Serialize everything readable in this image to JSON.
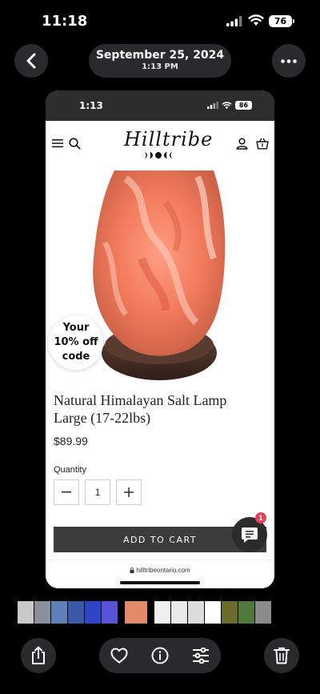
{
  "os_status": {
    "time": "11:18",
    "battery": "76"
  },
  "header": {
    "date": "September 25, 2024",
    "time": "1:13 PM"
  },
  "screenshot": {
    "status": {
      "time": "1:13",
      "battery": "86"
    },
    "site": {
      "logo_text": "Hilltribe"
    },
    "offer_bubble": {
      "line1": "Your",
      "line2": "10% off",
      "line3": "code"
    },
    "product": {
      "title": "Natural Himalayan Salt Lamp Large (17-22lbs)",
      "price": "$89.99",
      "quantity_label": "Quantity",
      "quantity_value": "1",
      "add_to_cart": "ADD TO CART"
    },
    "chat_badge": "1",
    "url": "hilltribeontario.com"
  },
  "thumbnails": [
    {
      "color": "#c9c9c9"
    },
    {
      "color": "#8a8f9c"
    },
    {
      "color": "#5f80b8"
    },
    {
      "color": "#3a5aa8"
    },
    {
      "color": "#2f43c8"
    },
    {
      "color": "#5a55d8"
    },
    {
      "color": "#e08a6a"
    },
    {
      "color": "#f0f0f0"
    },
    {
      "color": "#e9e9e9"
    },
    {
      "color": "#dcdcdc"
    },
    {
      "color": "#ffffff"
    },
    {
      "color": "#6b6b2a"
    },
    {
      "color": "#4f7a3a"
    },
    {
      "color": "#8c8c8c"
    }
  ]
}
